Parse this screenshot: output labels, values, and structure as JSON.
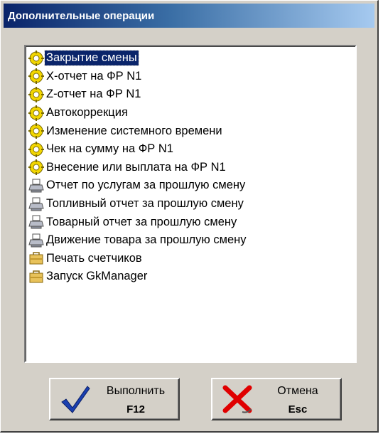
{
  "window": {
    "title": "Дополнительные операции"
  },
  "operations": [
    {
      "label": "Закрытие смены",
      "icon": "gear-icon",
      "selected": true
    },
    {
      "label": "X-отчет на ФР N1",
      "icon": "gear-icon"
    },
    {
      "label": "Z-отчет на ФР N1",
      "icon": "gear-icon"
    },
    {
      "label": "Автокоррекция",
      "icon": "gear-icon"
    },
    {
      "label": "Изменение системного времени",
      "icon": "gear-icon"
    },
    {
      "label": "Чек на сумму на ФР N1",
      "icon": "gear-icon"
    },
    {
      "label": "Внесение или выплата на ФР N1",
      "icon": "gear-icon"
    },
    {
      "label": "Отчет по услугам за прошлую смену",
      "icon": "printer-icon"
    },
    {
      "label": "Топливный отчет за прошлую смену",
      "icon": "printer-icon"
    },
    {
      "label": "Товарный отчет за прошлую смену",
      "icon": "printer-icon"
    },
    {
      "label": "Движение товара за прошлую смену",
      "icon": "printer-icon"
    },
    {
      "label": "Печать счетчиков",
      "icon": "briefcase-icon"
    },
    {
      "label": "Запуск GkManager",
      "icon": "briefcase-icon"
    }
  ],
  "buttons": {
    "execute": {
      "label": "Выполнить",
      "key": "F12",
      "icon": "checkmark-icon"
    },
    "cancel": {
      "label": "Отмена",
      "key": "Esc",
      "icon": "cross-icon"
    }
  },
  "colors": {
    "titlebar_start": "#0a246a",
    "titlebar_end": "#a6caf0",
    "selection": "#0a246a",
    "gear_icon": "#f2d600",
    "check_icon": "#1a3fb0",
    "cross_icon": "#e00000"
  }
}
